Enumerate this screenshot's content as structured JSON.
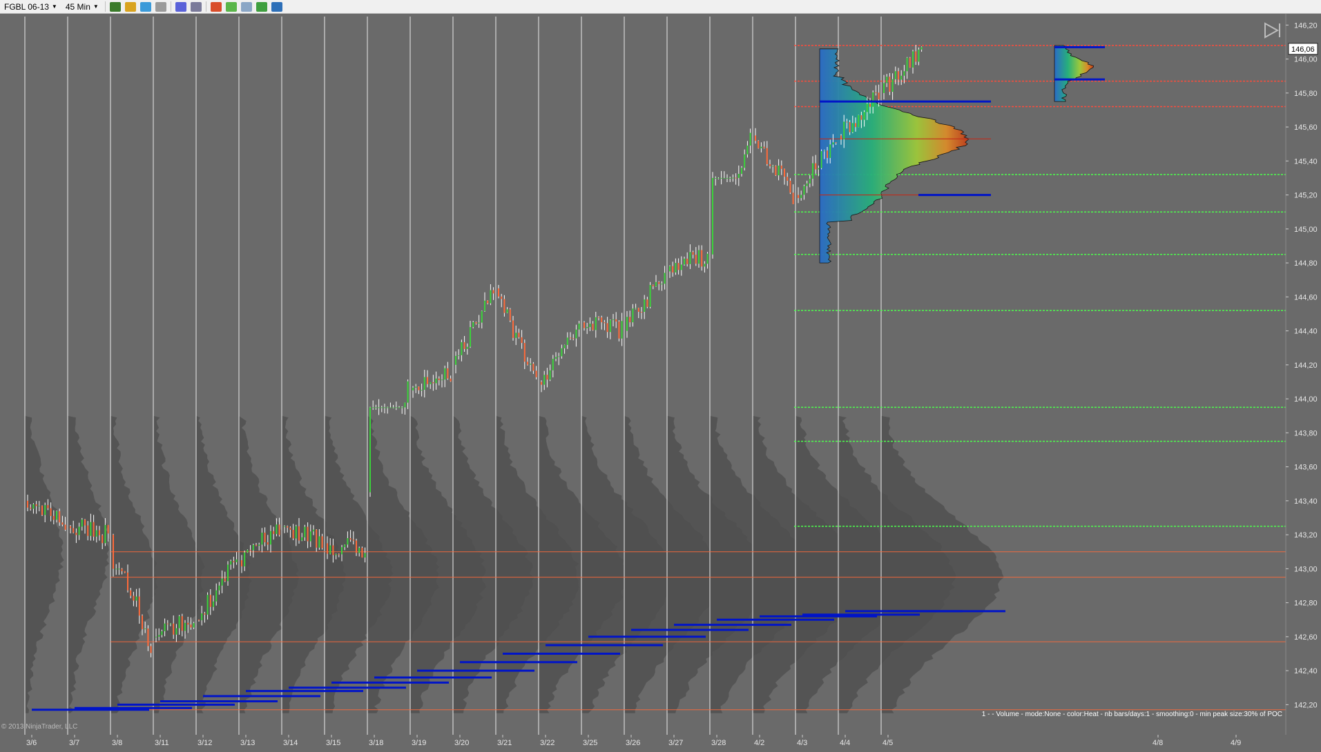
{
  "toolbar": {
    "instrument": "FGBL 06-13",
    "timeframe": "45 Min"
  },
  "footer": {
    "info": "1 -  - Volume - mode:None - color:Heat - nb bars/days:1 - smoothing:0 - min peak size:30% of POC",
    "copyright": "© 2013 NinjaTrader, LLC"
  },
  "price_label": "146,06",
  "colors": {
    "background": "#6a6a6a",
    "profile_gray": "#505050",
    "poc_orange": "#ff6a3a",
    "va_blue": "#0014c8",
    "level_green": "#4cff4c",
    "level_red": "#ff4b3a",
    "bull_candle": "#3bd23b",
    "bear_candle": "#ff6a3a",
    "wick": "#ffffff"
  },
  "chart_data": {
    "type": "market-profile",
    "instrument": "FGBL 06-13",
    "timeframe": "45 Min",
    "y_axis": {
      "ylim": [
        142.1,
        146.25
      ],
      "ticks": [
        "146,20",
        "146,00",
        "145,80",
        "145,60",
        "145,40",
        "145,20",
        "145,00",
        "144,80",
        "144,60",
        "144,40",
        "144,20",
        "144,00",
        "143,80",
        "143,60",
        "143,40",
        "143,20",
        "143,00",
        "142,80",
        "142,60",
        "142,40",
        "142,20"
      ]
    },
    "x_axis": {
      "ticks": [
        "3/6",
        "3/7",
        "3/8",
        "3/11",
        "3/12",
        "3/13",
        "3/14",
        "3/15",
        "3/18",
        "3/19",
        "3/20",
        "3/21",
        "3/22",
        "3/25",
        "3/26",
        "3/27",
        "3/28",
        "4/2",
        "4/3",
        "4/4",
        "4/5",
        "4/8",
        "4/9"
      ]
    },
    "sessions": [
      {
        "date": "3/6",
        "open": 143.4,
        "high": 143.45,
        "low": 143.1,
        "close": 143.25
      },
      {
        "date": "3/7",
        "open": 143.25,
        "high": 143.45,
        "low": 143.1,
        "close": 143.2
      },
      {
        "date": "3/8",
        "open": 143.2,
        "high": 143.0,
        "low": 142.28,
        "close": 142.55
      },
      {
        "date": "3/11",
        "open": 142.6,
        "high": 142.85,
        "low": 142.6,
        "close": 142.7
      },
      {
        "date": "3/12",
        "open": 142.7,
        "high": 143.2,
        "low": 142.52,
        "close": 143.05
      },
      {
        "date": "3/13",
        "open": 143.05,
        "high": 143.35,
        "low": 143.0,
        "close": 143.25
      },
      {
        "date": "3/14",
        "open": 143.25,
        "high": 143.25,
        "low": 142.85,
        "close": 143.15
      },
      {
        "date": "3/15",
        "open": 143.15,
        "high": 143.3,
        "low": 143.05,
        "close": 143.1
      },
      {
        "date": "3/18",
        "open": 143.45,
        "high": 144.4,
        "low": 143.95,
        "close": 144.05
      },
      {
        "date": "3/19",
        "open": 144.05,
        "high": 144.2,
        "low": 143.88,
        "close": 144.15
      },
      {
        "date": "3/20",
        "open": 144.2,
        "high": 144.78,
        "low": 144.2,
        "close": 144.65
      },
      {
        "date": "3/21",
        "open": 144.65,
        "high": 144.65,
        "low": 143.98,
        "close": 144.1
      },
      {
        "date": "3/22",
        "open": 144.1,
        "high": 144.5,
        "low": 144.05,
        "close": 144.4
      },
      {
        "date": "3/25",
        "open": 144.45,
        "high": 144.8,
        "low": 144.25,
        "close": 144.4
      },
      {
        "date": "3/26",
        "open": 144.4,
        "high": 144.9,
        "low": 144.0,
        "close": 144.75
      },
      {
        "date": "3/27",
        "open": 144.75,
        "high": 144.92,
        "low": 144.5,
        "close": 144.85
      },
      {
        "date": "3/28",
        "open": 144.85,
        "high": 145.85,
        "low": 145.3,
        "close": 145.55
      },
      {
        "date": "4/2",
        "open": 145.55,
        "high": 145.75,
        "low": 145.1,
        "close": 145.2
      },
      {
        "date": "4/3",
        "open": 145.2,
        "high": 145.65,
        "low": 145.15,
        "close": 145.55
      },
      {
        "date": "4/4",
        "open": 145.55,
        "high": 145.85,
        "low": 145.4,
        "close": 145.8
      },
      {
        "date": "4/5",
        "open": 145.8,
        "high": 146.08,
        "low": 145.75,
        "close": 146.06
      }
    ],
    "developing_poc": [
      143.1,
      143.1,
      142.95,
      142.95,
      142.95,
      142.95,
      142.95,
      142.95,
      142.95,
      142.95,
      142.95,
      142.95,
      142.95,
      142.95,
      142.95,
      142.95,
      142.95,
      142.95,
      142.95,
      142.95,
      142.95
    ],
    "value_area_low": [
      142.17,
      142.18,
      142.2,
      142.22,
      142.25,
      142.28,
      142.3,
      142.33,
      142.36,
      142.4,
      142.45,
      142.5,
      142.55,
      142.6,
      142.64,
      142.67,
      142.7,
      142.72,
      142.73,
      142.75,
      142.75
    ],
    "green_levels": [
      145.32,
      145.1,
      144.85,
      144.52,
      143.95,
      143.75,
      143.25
    ],
    "red_levels": [
      145.87,
      145.72,
      146.08
    ],
    "latest_value_area_lines": [
      146.07,
      145.88
    ],
    "poc_lines": [
      145.53,
      145.2,
      145.75
    ]
  }
}
